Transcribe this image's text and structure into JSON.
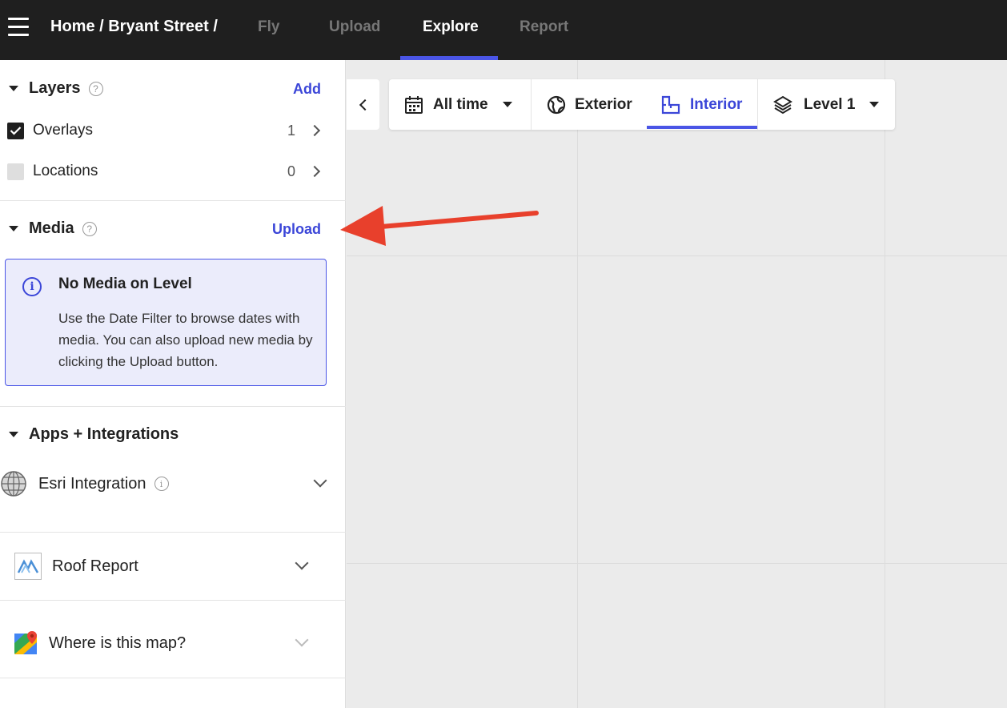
{
  "topbar": {
    "breadcrumb": "Home / Bryant Street /",
    "tabs": [
      {
        "label": "Fly"
      },
      {
        "label": "Upload"
      },
      {
        "label": "Explore"
      },
      {
        "label": "Report"
      }
    ],
    "active_tab": "Explore"
  },
  "sidebar": {
    "layers": {
      "title": "Layers",
      "action": "Add",
      "items": [
        {
          "label": "Overlays",
          "count": "1",
          "checked": true
        },
        {
          "label": "Locations",
          "count": "0",
          "checked": false
        }
      ]
    },
    "media": {
      "title": "Media",
      "action": "Upload",
      "notice_title": "No Media on Level",
      "notice_text": "Use the Date Filter to browse dates with media. You can also upload new media by clicking the Upload button."
    },
    "apps": {
      "title": "Apps + Integrations",
      "items": [
        {
          "label": "Esri Integration"
        },
        {
          "label": "Roof Report"
        },
        {
          "label": "Where is this map?"
        }
      ]
    }
  },
  "toolbar": {
    "date_filter": "All time",
    "exterior": "Exterior",
    "interior": "Interior",
    "level": "Level 1",
    "active": "Interior"
  },
  "colors": {
    "accent": "#4a55e6",
    "topbar_bg": "#1f1f1f",
    "annotation_arrow": "#e8402c"
  }
}
